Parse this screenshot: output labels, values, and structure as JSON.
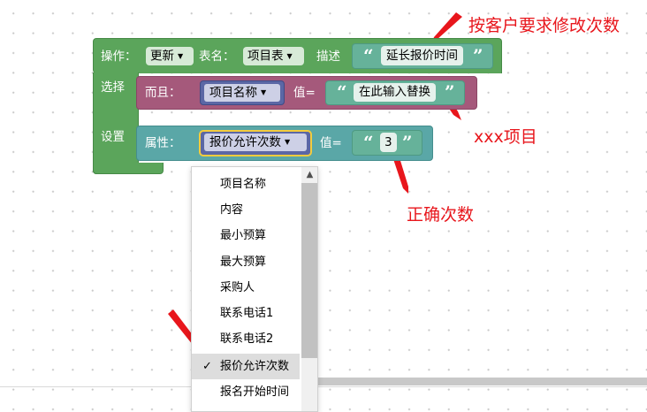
{
  "block": {
    "operation_label": "操作：",
    "operation_value": "更新",
    "table_label": "表名：",
    "table_value": "项目表",
    "desc_label": "描述",
    "desc_value": "延长报价时间",
    "select_label": "选择",
    "set_label": "设置",
    "condition_label": "而且：",
    "condition_field": "项目名称",
    "condition_eq": "值=",
    "condition_value": "在此输入替换",
    "attr_label": "属性：",
    "attr_field": "报价允许次数",
    "attr_eq": "值=",
    "attr_value": "3",
    "open_quote": "“",
    "close_quote": "”"
  },
  "menu": {
    "items": [
      "项目名称",
      "内容",
      "最小预算",
      "最大预算",
      "采购人",
      "联系电话1",
      "联系电话2",
      "报价允许次数",
      "报名开始时间"
    ],
    "selected": "报价允许次数",
    "check": "✓"
  },
  "annotations": {
    "a1": "按客户要求修改次数",
    "a2": "xxx项目",
    "a3": "正确次数"
  },
  "colors": {
    "block_green": "#5ba55b",
    "block_purple": "#a5597b",
    "block_teal": "#5aa7a7",
    "string_block": "#66b29a",
    "field_dropdown": "#5b67a5",
    "annotation_red": "#e8161c",
    "selection_highlight": "#f4cc3d"
  }
}
